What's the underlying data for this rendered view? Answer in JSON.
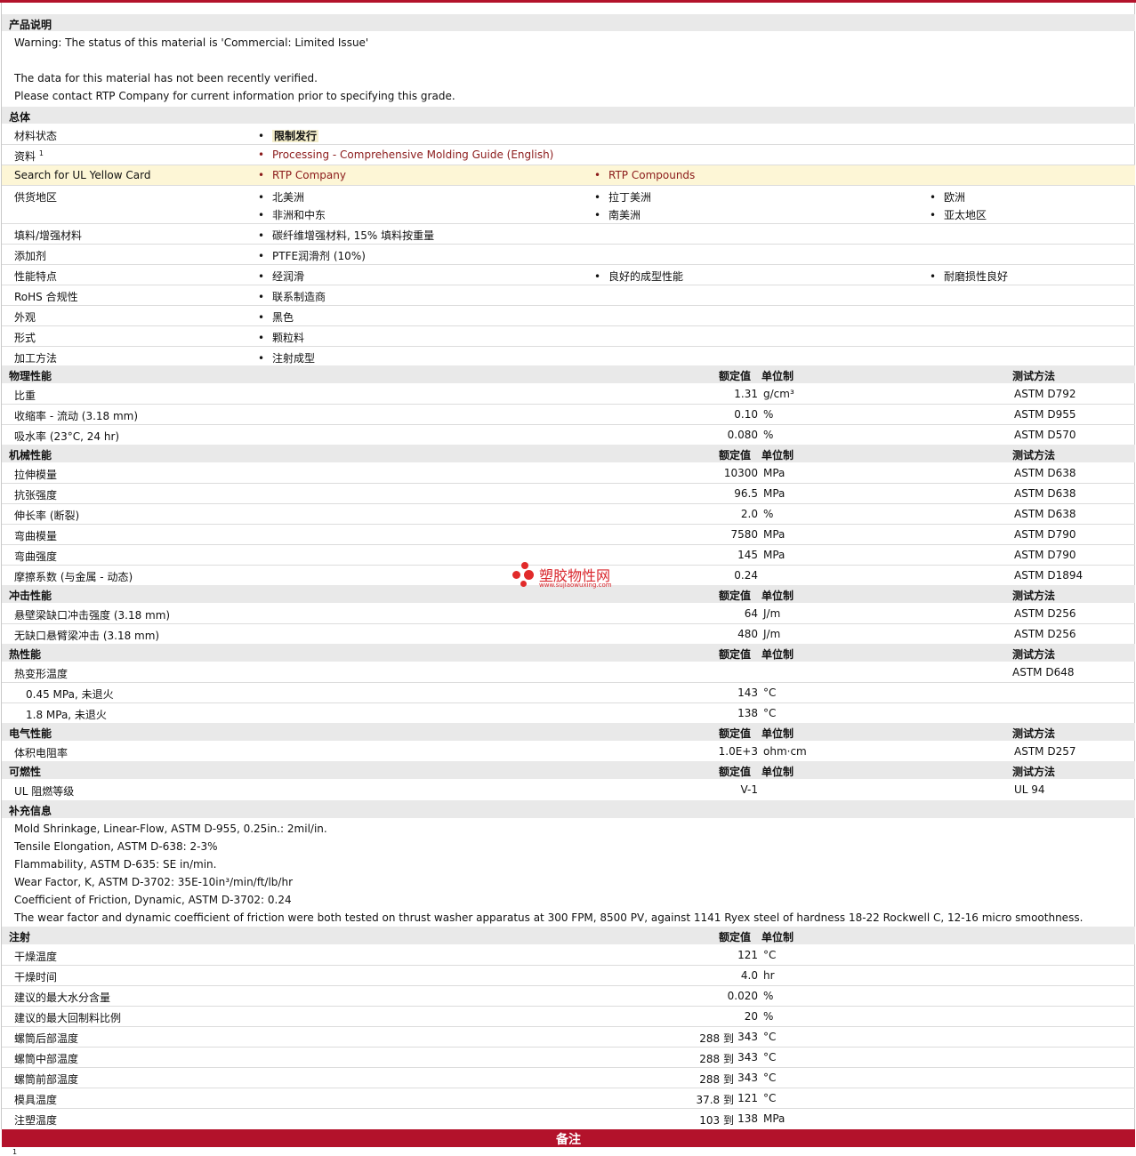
{
  "desc": {
    "header": "产品说明",
    "lines": [
      "Warning: The status of this material is 'Commercial: Limited Issue'",
      "The data for this material has not been recently verified.",
      "Please contact RTP Company for current information prior to specifying this grade."
    ]
  },
  "general": {
    "header": "总体",
    "status_label": "材料状态",
    "status_value": "限制发行",
    "docs_label": "资料",
    "docs_sup": "1",
    "docs_link": "Processing - Comprehensive Molding Guide (English)",
    "ul_label": "Search for UL Yellow Card",
    "ul_link1": "RTP Company",
    "ul_link2": "RTP Compounds",
    "region_label": "供货地区",
    "regions": [
      "北美洲",
      "拉丁美洲",
      "欧洲",
      "非洲和中东",
      "南美洲",
      "亚太地区"
    ],
    "filler_label": "填料/增强材料",
    "filler_value": "碳纤维增强材料, 15% 填料按重量",
    "additive_label": "添加剂",
    "additive_value": "PTFE润滑剂 (10%)",
    "feature_label": "性能特点",
    "features": [
      "经润滑",
      "良好的成型性能",
      "耐磨损性良好"
    ],
    "rohs_label": "RoHS 合规性",
    "rohs_value": "联系制造商",
    "appearance_label": "外观",
    "appearance_value": "黑色",
    "form_label": "形式",
    "form_value": "颗粒料",
    "process_label": "加工方法",
    "process_value": "注射成型"
  },
  "cols": {
    "nominal": "额定值",
    "unit": "单位制",
    "method": "测试方法"
  },
  "physical": {
    "header": "物理性能",
    "rows": [
      {
        "name": "比重",
        "value": "1.31",
        "unit": "g/cm³",
        "method": "ASTM D792"
      },
      {
        "name": "收缩率 - 流动 (3.18 mm)",
        "value": "0.10",
        "unit": "%",
        "method": "ASTM D955"
      },
      {
        "name": "吸水率 (23°C, 24 hr)",
        "value": "0.080",
        "unit": "%",
        "method": "ASTM D570"
      }
    ]
  },
  "mechanical": {
    "header": "机械性能",
    "rows": [
      {
        "name": "拉伸模量",
        "value": "10300",
        "unit": "MPa",
        "method": "ASTM D638"
      },
      {
        "name": "抗张强度",
        "value": "96.5",
        "unit": "MPa",
        "method": "ASTM D638"
      },
      {
        "name": "伸长率 (断裂)",
        "value": "2.0",
        "unit": "%",
        "method": "ASTM D638"
      },
      {
        "name": "弯曲模量",
        "value": "7580",
        "unit": "MPa",
        "method": "ASTM D790"
      },
      {
        "name": "弯曲强度",
        "value": "145",
        "unit": "MPa",
        "method": "ASTM D790"
      },
      {
        "name": "摩擦系数 (与金属 - 动态)",
        "value": "0.24",
        "unit": "",
        "method": "ASTM D1894"
      }
    ]
  },
  "impact": {
    "header": "冲击性能",
    "rows": [
      {
        "name": "悬壁梁缺口冲击强度 (3.18 mm)",
        "value": "64",
        "unit": "J/m",
        "method": "ASTM D256"
      },
      {
        "name": "无缺口悬臂梁冲击 (3.18 mm)",
        "value": "480",
        "unit": "J/m",
        "method": "ASTM D256"
      }
    ]
  },
  "thermal": {
    "header": "热性能",
    "hdt_label": "热变形温度",
    "hdt_method": "ASTM D648",
    "rows": [
      {
        "name": "0.45 MPa, 未退火",
        "value": "143",
        "unit": "°C"
      },
      {
        "name": "1.8 MPa, 未退火",
        "value": "138",
        "unit": "°C"
      }
    ]
  },
  "electrical": {
    "header": "电气性能",
    "rows": [
      {
        "name": "体积电阻率",
        "value": "1.0E+3",
        "unit": "ohm·cm",
        "method": "ASTM D257"
      }
    ]
  },
  "flammability": {
    "header": "可燃性",
    "rows": [
      {
        "name": "UL 阻燃等级",
        "value": "V-1",
        "unit": "",
        "method": "UL 94"
      }
    ]
  },
  "supplement": {
    "header": "补充信息",
    "lines": [
      "Mold Shrinkage, Linear-Flow, ASTM D-955, 0.25in.: 2mil/in.",
      "Tensile Elongation, ASTM D-638: 2-3%",
      "Flammability, ASTM D-635: SE in/min.",
      "Wear Factor, K, ASTM D-3702: 35E-10in³/min/ft/lb/hr",
      "Coefficient of Friction, Dynamic, ASTM D-3702: 0.24",
      "The wear factor and dynamic coefficient of friction were both tested on thrust washer apparatus at 300 FPM, 8500 PV, against 1141 Ryex steel of hardness 18-22 Rockwell C, 12-16 micro smoothness."
    ]
  },
  "injection": {
    "header": "注射",
    "to": "到",
    "rows": [
      {
        "name": "干燥温度",
        "low": "",
        "value": "121",
        "unit": "°C"
      },
      {
        "name": "干燥时间",
        "low": "",
        "value": "4.0",
        "unit": "hr"
      },
      {
        "name": "建议的最大水分含量",
        "low": "",
        "value": "0.020",
        "unit": "%"
      },
      {
        "name": "建议的最大回制料比例",
        "low": "",
        "value": "20",
        "unit": "%"
      },
      {
        "name": "螺筒后部温度",
        "low": "288",
        "value": "343",
        "unit": "°C"
      },
      {
        "name": "螺筒中部温度",
        "low": "288",
        "value": "343",
        "unit": "°C"
      },
      {
        "name": "螺筒前部温度",
        "low": "288",
        "value": "343",
        "unit": "°C"
      },
      {
        "name": "模具温度",
        "low": "37.8",
        "value": "121",
        "unit": "°C"
      },
      {
        "name": "注塑温度",
        "low": "103",
        "value": "138",
        "unit": "MPa"
      }
    ]
  },
  "notes": {
    "header": "备注",
    "first": "1"
  },
  "watermark": {
    "title": "塑胶物性网",
    "url": "www.sujiaowuxing.com"
  }
}
